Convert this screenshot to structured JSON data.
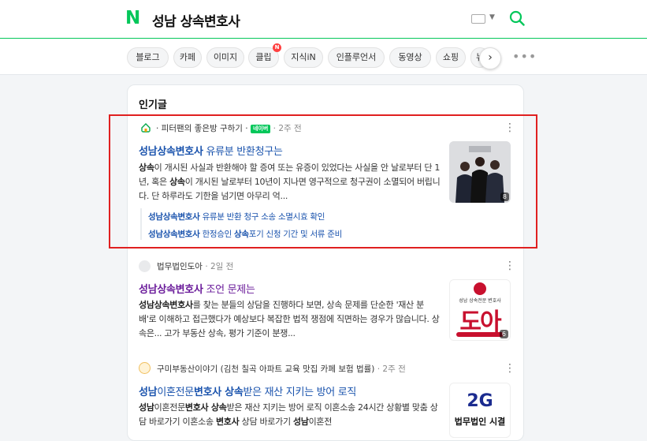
{
  "header": {
    "logo": "N",
    "query": "성남 상속변호사"
  },
  "tabs": [
    {
      "label": "블로그",
      "badge": null
    },
    {
      "label": "카페",
      "badge": null
    },
    {
      "label": "이미지",
      "badge": null
    },
    {
      "label": "클립",
      "badge": "N"
    },
    {
      "label": "지식iN",
      "badge": null
    },
    {
      "label": "인플루언서",
      "badge": null
    },
    {
      "label": "동영상",
      "badge": null
    },
    {
      "label": "쇼핑",
      "badge": null
    },
    {
      "label": "뉴",
      "badge": null
    }
  ],
  "section_title": "인기글",
  "posts": [
    {
      "source": "· 피터팬의 좋은방 구하기 ·",
      "source_tag": "네이버",
      "time": "· 2주 전",
      "title_hl": "성남상속변호사",
      "title_rest": " 유류분 반환청구는",
      "title_color": "#1a53ad",
      "body_html_parts": [
        {
          "b": "상속"
        },
        {
          "t": "이 개시된 사실과 반환해야 할 증여 또는 유증이 있었다는 사실을 안 날로부터 단 1년, 혹은 "
        },
        {
          "b": "상속"
        },
        {
          "t": "이 개시된 날로부터 10년이 지나면 영구적으로 청구권이 소멸되어 버립니다. 단 하루라도 기한을 넘기면 아무리 억..."
        }
      ],
      "thumb_count": "8",
      "sublinks": [
        {
          "hl": "성남상속변호사",
          "rest": " 유류분 반환 청구 소송 소멸시효 확인"
        },
        {
          "hl": "성남상속변호사",
          "rest": " 한정승인 ",
          "hl2": "상속",
          "rest2": "포기 신청 기간 및 서류 준비"
        }
      ]
    },
    {
      "source": "법무법인도아",
      "time": "· 2일 전",
      "title_hl": "성남상속변호사",
      "title_rest": " 조언 문제는",
      "title_color": "#6a1b9a",
      "body_parts": [
        {
          "b": "성남상속변호사"
        },
        {
          "t": "를 찾는 분들의 상담을 진행하다 보면, 상속 문제를 단순한 '재산 분배'로 이해하고 접근했다가 예상보다 복잡한 법적 쟁점에 직면하는 경우가 많습니다. 상속은... 고가 부동산 상속, 평가 기준이 분쟁..."
        }
      ],
      "thumb_text": "도아",
      "thumb_sub": "성남 상속전문 변호사",
      "thumb_count": "6"
    },
    {
      "source": "구미부동산이야기 (김천 칠곡 아파트 교육 맛집 카페 보험 법률)",
      "time": "· 2주 전",
      "title_parts": [
        {
          "b": "성남"
        },
        {
          "t": "이혼전문"
        },
        {
          "b": "변호사 상속"
        },
        {
          "t": "받은 재산 지키는 방어 로직"
        }
      ],
      "title_color": "#1a53ad",
      "body_parts": [
        {
          "b": "성남"
        },
        {
          "t": "이혼전문"
        },
        {
          "b": "변호사 상속"
        },
        {
          "t": "받은 재산 지키는 방어 로직 이혼소송 24시간 상황별 맞춤 상담 바로가기 이혼소송 "
        },
        {
          "b": "변호사"
        },
        {
          "t": " 상담 바로가기 "
        },
        {
          "b": "성남"
        },
        {
          "t": "이혼전"
        }
      ],
      "thumb_text": "2G",
      "thumb_sub": "법무법인 시결"
    }
  ]
}
